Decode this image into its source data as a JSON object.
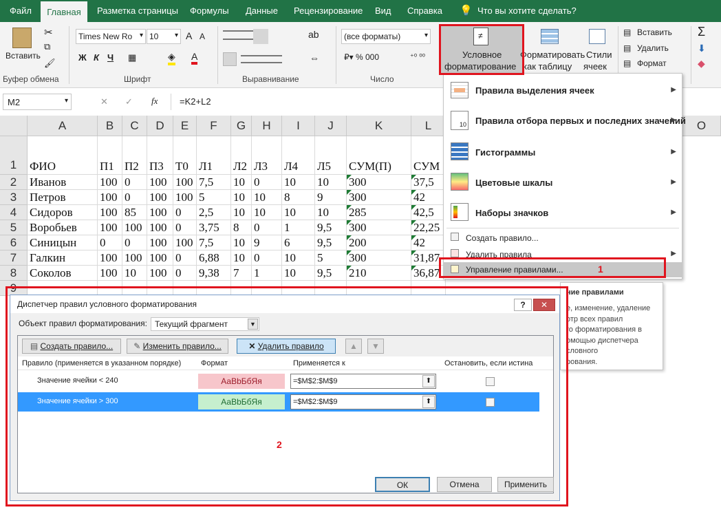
{
  "tabs": [
    "Файл",
    "Главная",
    "Разметка страницы",
    "Формулы",
    "Данные",
    "Рецензирование",
    "Вид",
    "Справка",
    "Что вы хотите сделать?"
  ],
  "ribbon": {
    "paste": "Вставить",
    "clipboard": "Буфер обмена",
    "font_group": "Шрифт",
    "font_name": "Times New Ro",
    "font_size": "10",
    "bold": "Ж",
    "italic": "К",
    "underline": "Ч",
    "align_group": "Выравнивание",
    "number_group": "Число",
    "number_format": "(все форматы)",
    "cond_fmt_line1": "Условное",
    "cond_fmt_line2": "форматирование",
    "fmt_table_line1": "Форматировать",
    "fmt_table_line2": "как таблицу",
    "styles_line1": "Стили",
    "styles_line2": "ячеек",
    "insert": "Вставить",
    "delete": "Удалить",
    "format": "Формат"
  },
  "formula": {
    "namebox": "M2",
    "fx": "fx",
    "formula": "=K2+L2"
  },
  "columns": [
    "A",
    "B",
    "C",
    "D",
    "E",
    "F",
    "G",
    "H",
    "I",
    "J",
    "K",
    "L",
    "O"
  ],
  "rows": [
    {
      "n": "1",
      "cells": [
        "ФИО",
        "П1",
        "П2",
        "П3",
        "Т0",
        "Л1",
        "Л2",
        "Л3",
        "Л4",
        "Л5",
        "СУМ(П)",
        "СУМ"
      ]
    },
    {
      "n": "2",
      "cells": [
        "Иванов",
        "100",
        "0",
        "100",
        "100",
        "7,5",
        "10",
        "0",
        "10",
        "10",
        "300",
        "37,5"
      ]
    },
    {
      "n": "3",
      "cells": [
        "Петров",
        "100",
        "0",
        "100",
        "100",
        "5",
        "10",
        "10",
        "8",
        "9",
        "300",
        "42"
      ]
    },
    {
      "n": "4",
      "cells": [
        "Сидоров",
        "100",
        "85",
        "100",
        "0",
        "2,5",
        "10",
        "10",
        "10",
        "10",
        "285",
        "42,5"
      ]
    },
    {
      "n": "5",
      "cells": [
        "Воробьев",
        "100",
        "100",
        "100",
        "0",
        "3,75",
        "8",
        "0",
        "1",
        "9,5",
        "300",
        "22,25"
      ]
    },
    {
      "n": "6",
      "cells": [
        "Синицын",
        "0",
        "0",
        "100",
        "100",
        "7,5",
        "10",
        "9",
        "6",
        "9,5",
        "200",
        "42"
      ]
    },
    {
      "n": "7",
      "cells": [
        "Галкин",
        "100",
        "100",
        "100",
        "0",
        "6,88",
        "10",
        "0",
        "10",
        "5",
        "300",
        "31,87"
      ]
    },
    {
      "n": "8",
      "cells": [
        "Соколов",
        "100",
        "10",
        "100",
        "0",
        "9,38",
        "7",
        "1",
        "10",
        "9,5",
        "210",
        "36,87"
      ]
    },
    {
      "n": "9",
      "cells": [
        "",
        "",
        "",
        "",
        "",
        "",
        "",
        "",
        "",
        "",
        "",
        ""
      ]
    }
  ],
  "menu": {
    "items": [
      "Правила выделения ячеек",
      "Правила отбора первых и последних значений",
      "Гистограммы",
      "Цветовые шкалы",
      "Наборы значков",
      "Создать правило...",
      "Удалить правила",
      "Управление правилами..."
    ],
    "marker1": "1"
  },
  "tooltip": {
    "title": "ние правилами",
    "lines": [
      "е, изменение, удаление",
      "отр всех правил",
      "го форматирования в",
      "омощью диспетчера",
      "словного",
      "рования."
    ]
  },
  "dialog": {
    "title": "Диспетчер правил условного форматирования",
    "scope_label": "Объект правил форматирования:",
    "scope_value": "Текущий фрагмент",
    "new_rule": "Создать правило...",
    "edit_rule": "Изменить правило...",
    "delete_rule": "Удалить правило",
    "headers": [
      "Правило (применяется в указанном порядке)",
      "Формат",
      "Применяется к",
      "Остановить, если истина"
    ],
    "rules": [
      {
        "rule": "Значение ячейки < 240",
        "format": "АаВbБбЯя",
        "applies": "=$M$2:$M$9",
        "fmt_bg": "#f7c6cb",
        "fmt_fg": "#9c1c2a"
      },
      {
        "rule": "Значение ячейки > 300",
        "format": "АаВbБбЯя",
        "applies": "=$M$2:$M$9",
        "fmt_bg": "#c6efce",
        "fmt_fg": "#1e6b32"
      }
    ],
    "marker2": "2",
    "ok": "ОК",
    "cancel": "Отмена",
    "apply": "Применить",
    "help": "?",
    "close": "✕"
  },
  "colors": {
    "excel_green": "#217346",
    "highlight": "#e0141e",
    "selected_row": "#3399ff"
  }
}
